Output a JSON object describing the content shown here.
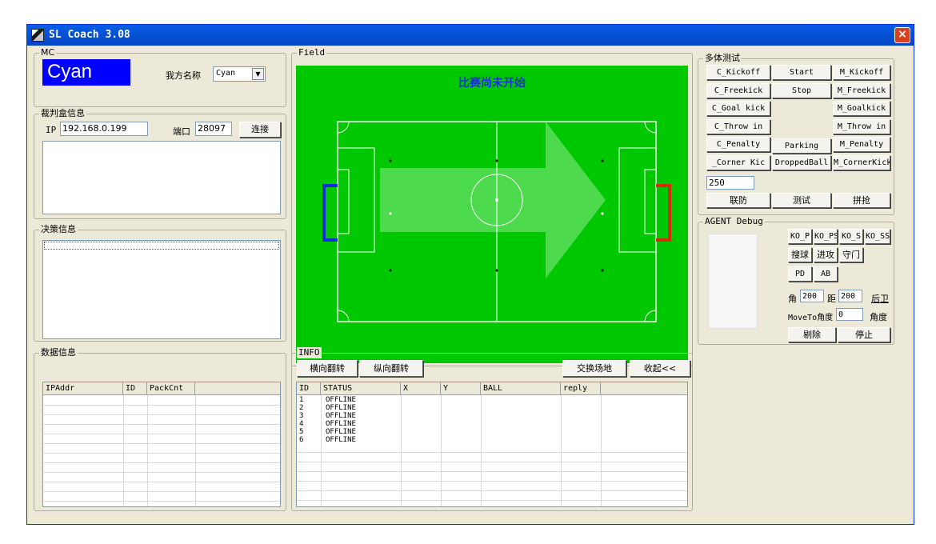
{
  "window": {
    "title": "SL Coach 3.08",
    "close": "×"
  },
  "mc": {
    "legend": "MC",
    "team_display": "Cyan",
    "team_name_label": "我方名称",
    "team_select": "Cyan"
  },
  "referee": {
    "legend": "裁判盒信息",
    "ip_label": "IP",
    "ip_value": "192.168.0.199",
    "port_label": "端口",
    "port_value": "28097",
    "connect_button": "连接"
  },
  "decision": {
    "legend": "决策信息"
  },
  "data_info": {
    "legend": "数据信息",
    "columns": [
      "IPAddr",
      "ID",
      "PackCnt"
    ]
  },
  "field": {
    "legend": "Field",
    "status_text": "比赛尚未开始",
    "colors": {
      "grass": "#00c800",
      "left_goal": "#0a2fd6",
      "right_goal": "#d62a0a"
    }
  },
  "info": {
    "legend": "INFO",
    "buttons": {
      "flip_h": "横向翻转",
      "flip_v": "纵向翻转",
      "swap": "交换场地",
      "collapse": "收起<<"
    },
    "columns": [
      "ID",
      "STATUS",
      "X",
      "Y",
      "BALL",
      "reply"
    ],
    "rows": [
      {
        "id": "1",
        "status": "OFFLINE"
      },
      {
        "id": "2",
        "status": "OFFLINE"
      },
      {
        "id": "3",
        "status": "OFFLINE"
      },
      {
        "id": "4",
        "status": "OFFLINE"
      },
      {
        "id": "5",
        "status": "OFFLINE"
      },
      {
        "id": "6",
        "status": "OFFLINE"
      }
    ]
  },
  "multi_test": {
    "legend": "多体测试",
    "left": [
      "C_Kickoff",
      "C_Freekick",
      "C_Goal kick",
      "C_Throw in",
      "C_Penalty",
      "_Corner Kic"
    ],
    "middle": {
      "start": "Start",
      "stop": "Stop",
      "parking": "Parking",
      "dropped": "DroppedBall"
    },
    "right": [
      "M_Kickoff",
      "M_Freekick",
      "M_Goalkick",
      "M_Throw in",
      "M_Penalty",
      "M_CornerKick"
    ],
    "input_value": "250",
    "defense": "联防",
    "test": "测试",
    "scramble": "拼抢"
  },
  "agent_debug": {
    "legend": "AGENT Debug",
    "ko_buttons": [
      "KO_P",
      "KO_PS",
      "KO_S",
      "KO_SS"
    ],
    "action_buttons": [
      "搜球",
      "进攻",
      "守门"
    ],
    "pd": "PD",
    "ab": "AB",
    "angle_label": "角",
    "angle_value": "200",
    "dist_label": "距",
    "dist_value": "200",
    "back": "后卫",
    "moveto_label": "MoveTo角度",
    "moveto_value": "0",
    "angle_button": "角度",
    "remove": "剔除",
    "stop": "停止"
  }
}
